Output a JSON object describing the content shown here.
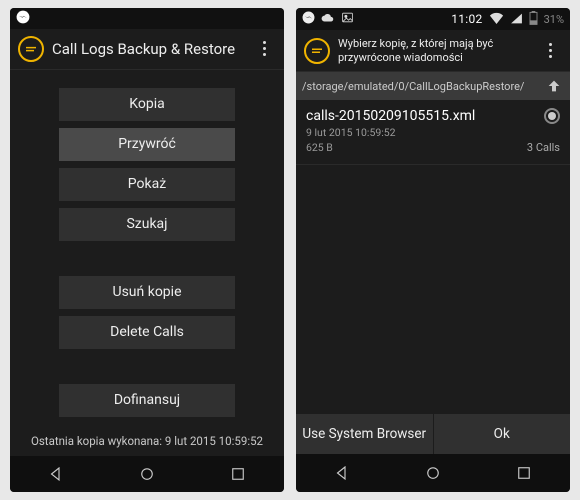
{
  "left": {
    "app_title": "Call Logs Backup & Restore",
    "buttons": {
      "copy": "Kopia",
      "restore": "Przywróć",
      "show": "Pokaż",
      "search": "Szukaj",
      "delete_copies": "Usuń kopie",
      "delete_calls": "Delete Calls",
      "donate": "Dofinansuj"
    },
    "last_backup": "Ostatnia kopia wykonana: 9 lut 2015 10:59:52"
  },
  "right": {
    "status": {
      "time": "11:02",
      "batt": "31%"
    },
    "app_title": "Wybierz kopię, z której mają być przywrócone wiadomości",
    "path": "/storage/emulated/0/CallLogBackupRestore/",
    "file": {
      "name": "calls-20150209105515.xml",
      "date": "9 lut 2015 10:59:52",
      "size": "625 B",
      "calls": "3 Calls"
    },
    "actions": {
      "system_browser": "Use System Browser",
      "ok": "Ok"
    }
  }
}
